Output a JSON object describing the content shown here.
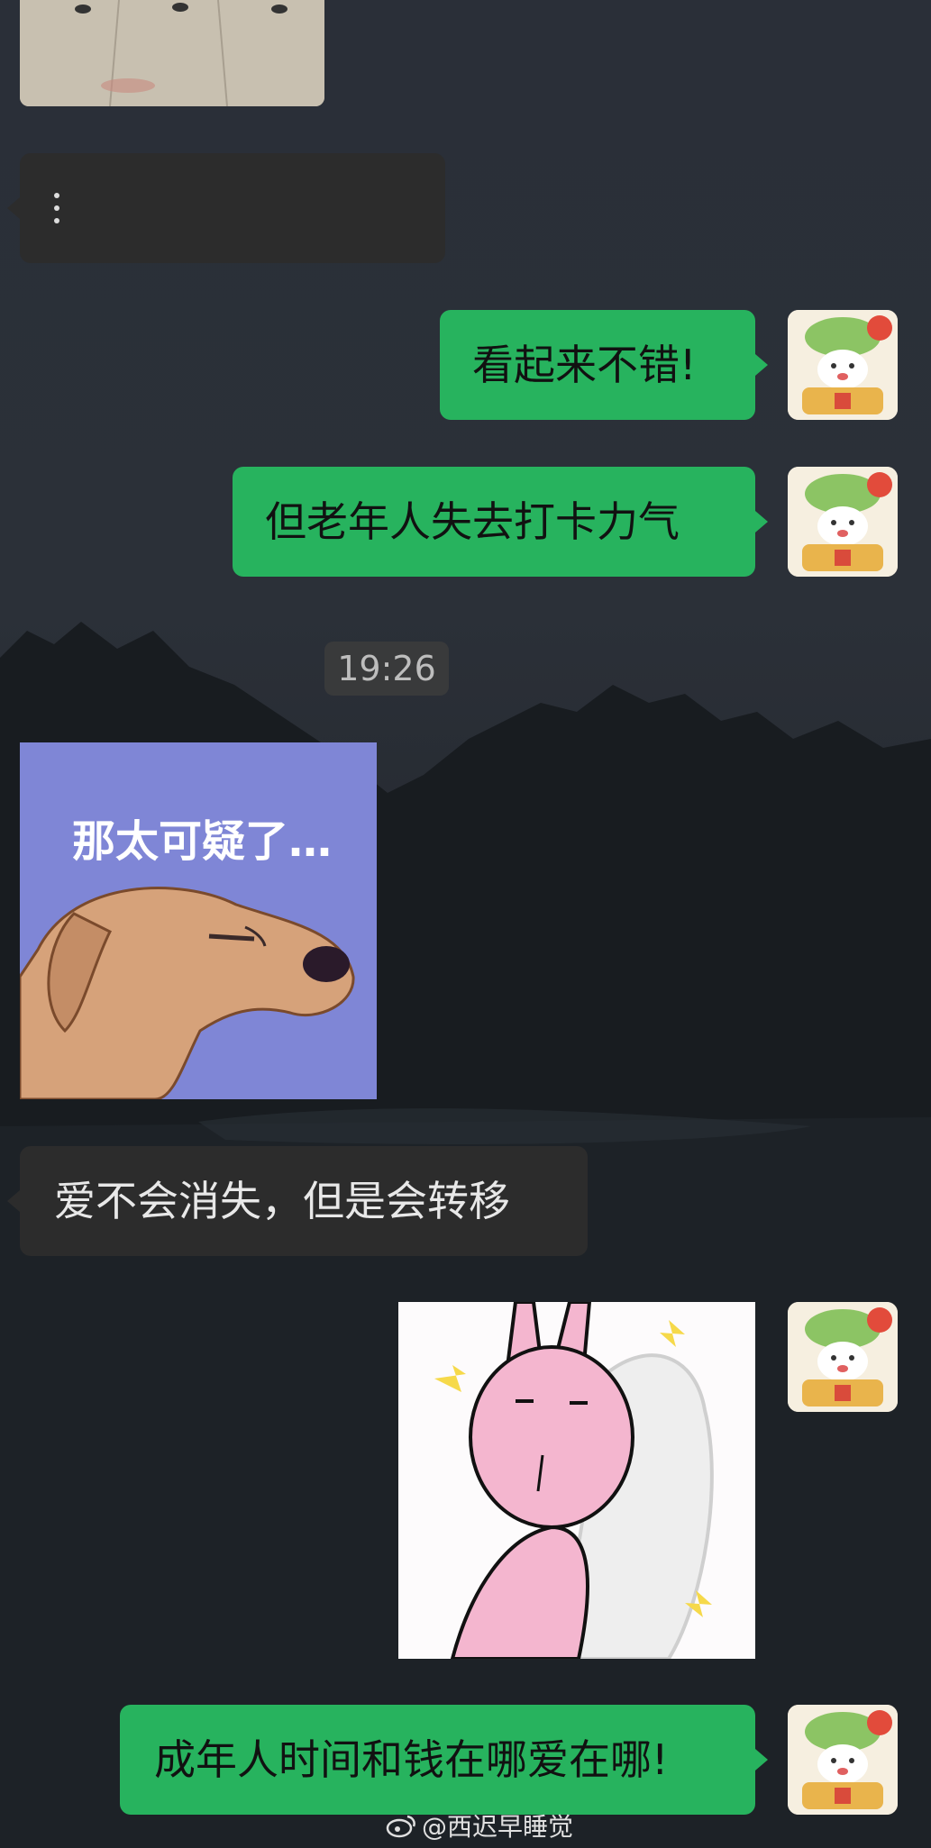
{
  "messages": {
    "m1_text": "看起来不错!",
    "m2_text": "但老年人失去打卡力气",
    "m3_text": "爱不会消失，但是会转移",
    "m4_text": "成年人时间和钱在哪爱在哪!"
  },
  "timestamp": "19:26",
  "stickers": {
    "dog_caption": "那太可疑了…"
  },
  "watermark": {
    "handle": "@西迟早睡觉",
    "icon": "weibo-icon"
  },
  "colors": {
    "sent_bubble": "#27b35e",
    "received_bubble": "#2c2c2c",
    "timestamp_bg": "#3c3c3c",
    "dog_sticker_bg": "#7f86d6"
  }
}
